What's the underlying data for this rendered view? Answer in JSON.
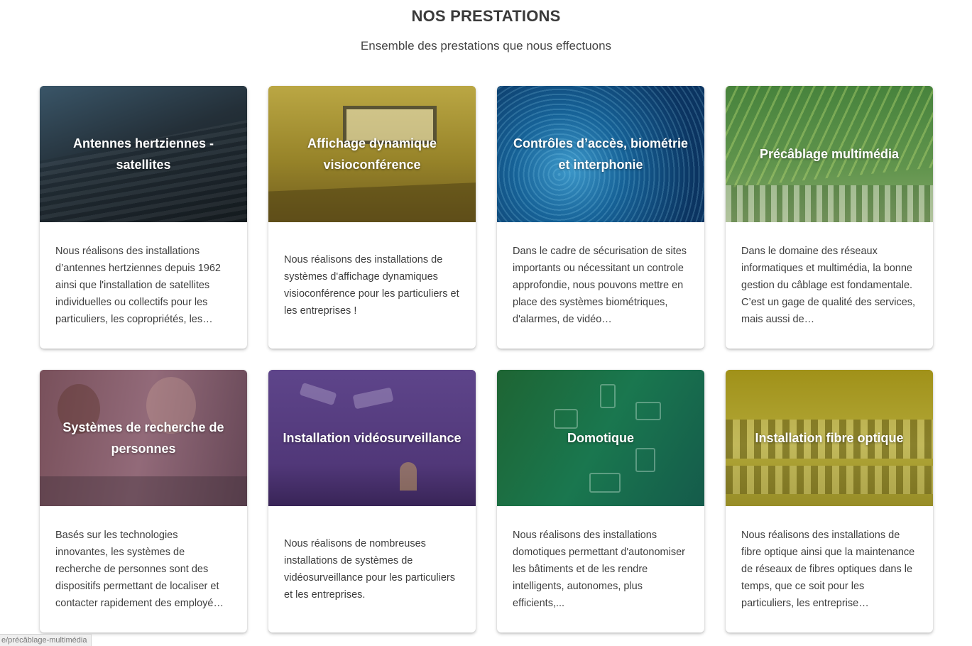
{
  "header": {
    "title": "NOS PRESTATIONS",
    "subtitle": "Ensemble des prestations que nous effectuons"
  },
  "cards": [
    {
      "title": "Antennes hertziennes - satellites",
      "text": "Nous réalisons des installations d’antennes hertziennes depuis 1962 ainsi que l'installation de satellites individuelles ou collectifs pour les particuliers, les copropriétés, les…",
      "color": "#2c3a44"
    },
    {
      "title": "Affichage dynamique visioconférence",
      "text": "Nous réalisons des installations de systèmes d'affichage dynamiques visioconférence pour les particuliers et les entreprises !",
      "color": "#9a8a2e"
    },
    {
      "title": "Contrôles d’accès, biométrie et interphonie",
      "text": "Dans le cadre de sécurisation de sites importants ou nécessitant un controle approfondie, nous pouvons mettre en place des systèmes biométriques, d'alarmes, de vidéo…",
      "color": "#1a5f8a"
    },
    {
      "title": "Précâblage multimédia",
      "text": "Dans le domaine des réseaux informatiques et multimédia, la bonne gestion du câblage est fondamentale. C’est un gage de qualité des services, mais aussi de…",
      "color": "#4f8a3d"
    },
    {
      "title": "Systèmes de recherche de personnes",
      "text": "Basés sur les technologies innovantes, les systèmes de recherche de personnes sont des dispositifs permettant de localiser et contacter rapidement des employé…",
      "color": "#7d5363"
    },
    {
      "title": "Installation vidéosurveillance",
      "text": "Nous réalisons de nombreuses installations de systèmes de vidéosurveillance pour les particuliers et les entreprises.",
      "color": "#553a7d"
    },
    {
      "title": "Domotique",
      "text": "Nous réalisons des installations domotiques permettant d'autonomiser les bâtiments et de les rendre intelligents, autonomes, plus efficients,...",
      "color": "#1f6e45"
    },
    {
      "title": "Installation fibre optique",
      "text": "Nous réalisons des installations de fibre optique ainsi que la maintenance de réseaux de fibres optiques dans le temps, que ce soit pour les particuliers, les entreprise…",
      "color": "#a39418"
    }
  ],
  "status_bar": {
    "url": "e/précâblage-multimédia"
  }
}
